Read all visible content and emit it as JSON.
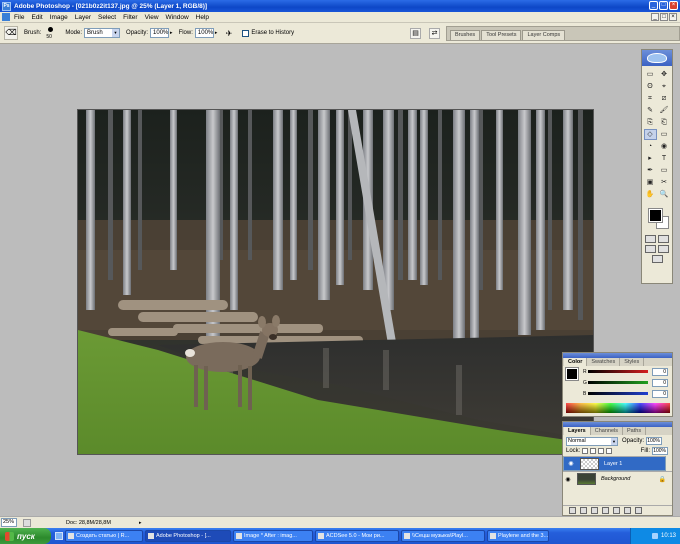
{
  "window": {
    "title": "Adobe Photoshop - [021b0z2it137.jpg @ 25% (Layer 1, RGB/8)]",
    "app_icon_text": "Ps",
    "minimize": "_",
    "maximize": "□",
    "close": "×"
  },
  "menu": {
    "items": [
      "File",
      "Edit",
      "Image",
      "Layer",
      "Select",
      "Filter",
      "View",
      "Window",
      "Help"
    ],
    "mdi_minimize": "_",
    "mdi_restore": "□",
    "mdi_close": "×"
  },
  "options": {
    "tool_icon": "eraser-icon",
    "brush_label": "Brush:",
    "brush_size": "50",
    "mode_label": "Mode:",
    "mode_value": "Brush",
    "opacity_label": "Opacity:",
    "opacity_value": "100%",
    "flow_label": "Flow:",
    "flow_value": "100%",
    "erase_history_label": "Erase to History",
    "palette_well_tabs": [
      "Brushes",
      "Tool Presets",
      "Layer Comps"
    ]
  },
  "toolbox": {
    "tools": [
      "▭",
      "✥",
      "ʘ",
      "⌖",
      "⌗",
      "⧄",
      "✎",
      "🖌",
      "⎘",
      "⎗",
      "◇",
      "▭",
      "◔",
      "◉",
      "▸",
      "T",
      "✒",
      "▭",
      "▣",
      "✂",
      "✋",
      "🔍"
    ]
  },
  "color_palette": {
    "tabs": [
      "Color",
      "Swatches",
      "Styles"
    ],
    "sliders": [
      {
        "label": "R",
        "value": "0",
        "color": "#d42020"
      },
      {
        "label": "G",
        "value": "0",
        "color": "#20a020"
      },
      {
        "label": "B",
        "value": "0",
        "color": "#2040d0"
      }
    ]
  },
  "layers_palette": {
    "tabs": [
      "Layers",
      "Channels",
      "Paths"
    ],
    "blend_mode": "Normal",
    "opacity_label": "Opacity:",
    "opacity_value": "100%",
    "lock_label": "Lock:",
    "fill_label": "Fill:",
    "fill_value": "100%",
    "layers": [
      {
        "name": "Layer 1",
        "selected": true
      },
      {
        "name": "Background",
        "selected": false
      }
    ]
  },
  "status": {
    "zoom": "25%",
    "doc_info": "Doc: 28,8M/28,8M"
  },
  "taskbar": {
    "start_label": "пуск",
    "tasks": [
      {
        "label": "Создать статью | R...",
        "active": false
      },
      {
        "label": "Adobe Photoshop - [...",
        "active": true
      },
      {
        "label": "Image * After : imag...",
        "active": false
      },
      {
        "label": "ACDSee 5.0 - Мои ри...",
        "active": false
      },
      {
        "label": "\\\\Сецш музыка\\Playl...",
        "active": false
      },
      {
        "label": "Playlene and the 3...",
        "active": false
      }
    ],
    "clock": "10:13"
  }
}
